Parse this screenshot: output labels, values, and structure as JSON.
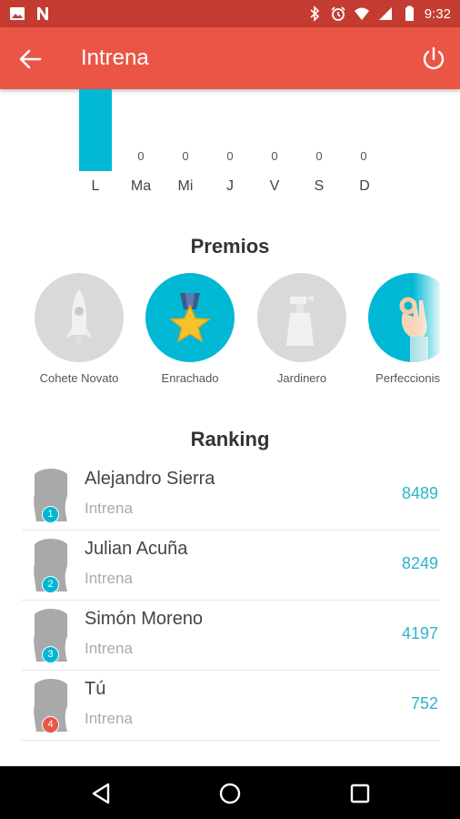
{
  "status_bar": {
    "time": "9:32",
    "icons": [
      "image-icon",
      "n-icon",
      "bluetooth-icon",
      "alarm-icon",
      "wifi-icon",
      "signal-icon",
      "battery-icon"
    ]
  },
  "app_bar": {
    "title": "Intrena",
    "back_icon": "arrow-left-icon",
    "power_icon": "power-icon",
    "color": "#ea5546"
  },
  "chart_data": {
    "type": "bar",
    "categories": [
      "L",
      "Ma",
      "Mi",
      "J",
      "V",
      "S",
      "D"
    ],
    "values": [
      null,
      0,
      0,
      0,
      0,
      0,
      0
    ],
    "value_labels": [
      "",
      "0",
      "0",
      "0",
      "0",
      "0",
      "0"
    ],
    "bar_color": "#00b8d4"
  },
  "awards": {
    "heading": "Premios",
    "items": [
      {
        "label": "Cohete Novato",
        "icon": "rocket-icon",
        "unlocked": false
      },
      {
        "label": "Enrachado",
        "icon": "medal-star-icon",
        "unlocked": true
      },
      {
        "label": "Jardinero",
        "icon": "spray-bottle-icon",
        "unlocked": false
      },
      {
        "label": "Perfeccionista",
        "icon": "ok-hand-icon",
        "unlocked": true
      }
    ]
  },
  "ranking": {
    "heading": "Ranking",
    "rows": [
      {
        "position": "1",
        "name": "Alejandro Sierra",
        "subtitle": "Intrena",
        "score": "8489",
        "badge_color": "#00b8d4"
      },
      {
        "position": "2",
        "name": "Julian Acuña",
        "subtitle": "Intrena",
        "score": "8249",
        "badge_color": "#00b8d4"
      },
      {
        "position": "3",
        "name": "Simón Moreno",
        "subtitle": "Intrena",
        "score": "4197",
        "badge_color": "#00b8d4"
      },
      {
        "position": "4",
        "name": "Tú",
        "subtitle": "Intrena",
        "score": "752",
        "badge_color": "#ea5546"
      }
    ]
  },
  "nav_bar": {
    "icons": [
      "back-triangle-icon",
      "home-circle-icon",
      "recents-square-icon"
    ]
  }
}
